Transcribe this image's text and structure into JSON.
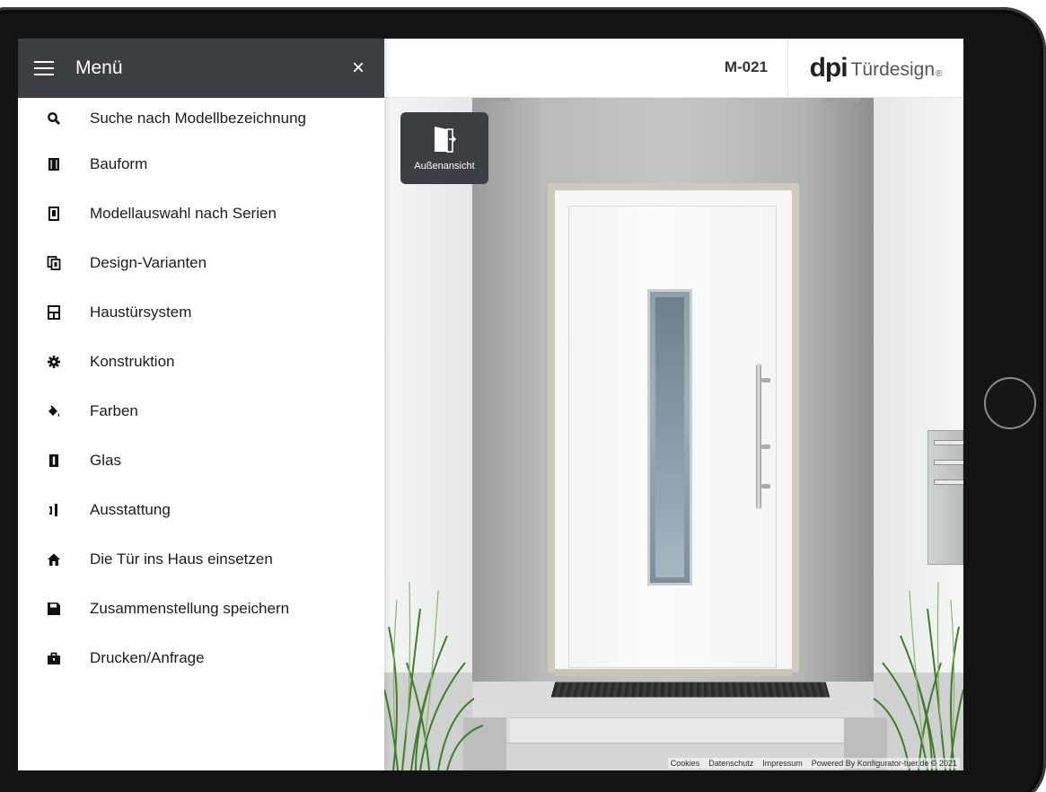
{
  "header": {
    "model_code": "M-021",
    "brand_dpi": "dpi",
    "brand_name": "Türdesign",
    "brand_mark": "®"
  },
  "view_toggle": {
    "label": "Außenansicht",
    "icon": "door-exit-icon"
  },
  "menu": {
    "title": "Menü",
    "close_label": "×",
    "items": [
      {
        "label": "Suche nach Modellbezeichnung",
        "icon": "search-icon"
      },
      {
        "label": "Bauform",
        "icon": "door-form-icon"
      },
      {
        "label": "Modellauswahl nach Serien",
        "icon": "door-series-icon"
      },
      {
        "label": "Design-Varianten",
        "icon": "copy-variants-icon"
      },
      {
        "label": "Haustürsystem",
        "icon": "door-system-icon"
      },
      {
        "label": "Konstruktion",
        "icon": "gear-icon"
      },
      {
        "label": "Farben",
        "icon": "paint-bucket-icon"
      },
      {
        "label": "Glas",
        "icon": "glass-panel-icon"
      },
      {
        "label": "Ausstattung",
        "icon": "door-handle-icon"
      },
      {
        "label": "Die Tür ins Haus einsetzen",
        "icon": "house-icon"
      },
      {
        "label": "Zusammenstellung speichern",
        "icon": "save-icon"
      },
      {
        "label": "Drucken/Anfrage",
        "icon": "briefcase-icon"
      }
    ]
  },
  "footer": {
    "links": [
      "Cookies",
      "Datenschutz",
      "Impressum",
      "Powered By Konfigurator-tuer.de © 2021"
    ]
  },
  "colors": {
    "menu_header_bg": "#3b3f44",
    "accent_text": "#222222"
  }
}
